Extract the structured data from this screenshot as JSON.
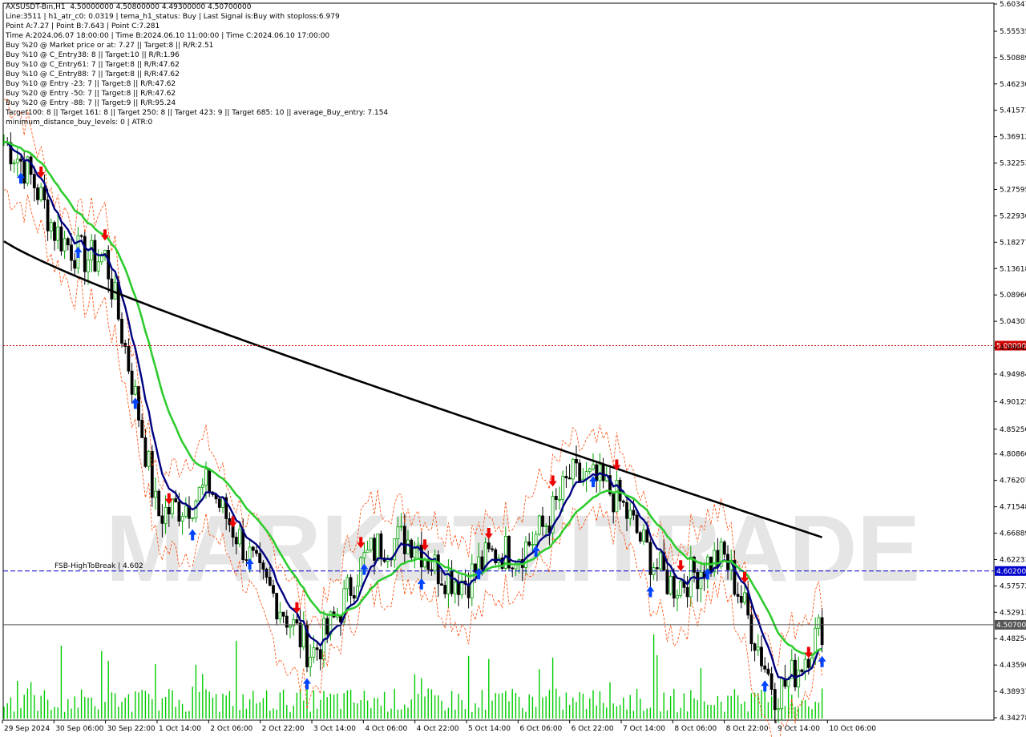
{
  "info_lines": [
    "AXSUSDT-Bin,H1  4.50000000 4.50800000 4.49300000 4.50700000",
    "Line:3511 | h1_atr_c0: 0.0319 | tema_h1_status: Buy | Last Signal is:Buy with stoploss:6.979",
    "Point A:7.27 | Point B:7.643 | Point C:7.281",
    "Time A:2024.06.07 18:00:00 | Time B:2024.06.10 11:00:00 | Time C:2024.06.10 17:00:00",
    "Buy %20 @ Market price or at: 7.27 || Target:8 || R/R:2.51",
    "Buy %10 @ C_Entry38: 8 || Target:10 || R/R:1.96",
    "Buy %10 @ C_Entry61: 7 || Target:8 || R/R:47.62",
    "Buy %10 @ C_Entry88: 7 || Target:8 || R/R:47.62",
    "Buy %10 @ Entry -23: 7 || Target:8 || R/R:47.62",
    "Buy %20 @ Entry -50: 7 || Target:8 || R/R:47.62",
    "Buy %20 @ Entry -88: 7 || Target:9 || R/R:95.24",
    "Target100: 8 || Target 161: 8 || Target 250: 8 || Target 423: 9 || Target 685: 10 || average_Buy_entry: 7.154",
    "minimum_distance_buy_levels: 0 | ATR:0"
  ],
  "watermark": "MARKETZITRADE",
  "price_labels": [
    "5.60347",
    "5.55535",
    "5.50889",
    "5.46230",
    "5.41571",
    "5.36912",
    "5.32253",
    "5.27595",
    "5.22936",
    "5.18277",
    "5.13618",
    "5.08960",
    "5.04301",
    "4.99642",
    "4.94984",
    "4.90125",
    "4.85250",
    "4.80866",
    "4.76207",
    "4.71548",
    "4.66889",
    "4.62231",
    "4.57572",
    "4.52913",
    "4.48254",
    "4.43596",
    "4.38937",
    "4.34278"
  ],
  "price_range": [
    4.34278,
    5.60347
  ],
  "time_labels": [
    "29 Sep 2024",
    "30 Sep 06:00",
    "30 Sep 22:00",
    "1 Oct 14:00",
    "2 Oct 06:00",
    "2 Oct 22:00",
    "3 Oct 14:00",
    "4 Oct 06:00",
    "4 Oct 22:00",
    "5 Oct 14:00",
    "6 Oct 06:00",
    "6 Oct 22:00",
    "7 Oct 14:00",
    "8 Oct 06:00",
    "8 Oct 22:00",
    "9 Oct 14:00",
    "10 Oct 06:00"
  ],
  "levels": [
    {
      "name": "level-5",
      "price": 5.0,
      "label": "5.00000",
      "color": "#d00000",
      "style": "dotted"
    },
    {
      "name": "fsb-high-to-break",
      "price": 4.602,
      "label": "4.60200",
      "caption": "FSB-HighToBreak | 4.602",
      "color": "#0000cc",
      "style": "dashed"
    },
    {
      "name": "current-price",
      "price": 4.507,
      "label": "4.50700",
      "color": "#555555",
      "style": "solid"
    }
  ],
  "colors": {
    "up": "#00a000",
    "down": "#000000",
    "ma_fast": "#000080",
    "ma_mid": "#2ecc2e",
    "ma_slow": "#000000",
    "envelope": "#ff4500",
    "buy_arrow": "#0044ff",
    "sell_arrow": "#ee0000",
    "volume": "#00cc00"
  },
  "chart_data": {
    "type": "candlestick",
    "symbol": "AXSUSDT-Bin",
    "timeframe": "H1",
    "last_ohlc": {
      "open": 4.5,
      "high": 4.508,
      "low": 4.493,
      "close": 4.507
    },
    "ylim": [
      4.34278,
      5.60347
    ],
    "series_anchors": [
      {
        "x": "29 Sep 2024",
        "price": 5.36
      },
      {
        "x": "30 Sep 06:00",
        "price": 5.2
      },
      {
        "x": "30 Sep 22:00",
        "price": 5.17
      },
      {
        "x": "1 Oct 14:00",
        "price": 4.68
      },
      {
        "x": "2 Oct 06:00",
        "price": 4.78
      },
      {
        "x": "2 Oct 22:00",
        "price": 4.56
      },
      {
        "x": "3 Oct 14:00",
        "price": 4.48
      },
      {
        "x": "4 Oct 06:00",
        "price": 4.6
      },
      {
        "x": "4 Oct 22:00",
        "price": 4.67
      },
      {
        "x": "5 Oct 14:00",
        "price": 4.58
      },
      {
        "x": "6 Oct 06:00",
        "price": 4.63
      },
      {
        "x": "6 Oct 22:00",
        "price": 4.78
      },
      {
        "x": "7 Oct 14:00",
        "price": 4.7
      },
      {
        "x": "8 Oct 06:00",
        "price": 4.6
      },
      {
        "x": "8 Oct 22:00",
        "price": 4.6
      },
      {
        "x": "9 Oct 14:00",
        "price": 4.41
      },
      {
        "x": "10 Oct 06:00",
        "price": 4.5
      }
    ],
    "moving_averages": [
      {
        "color": "navy",
        "role": "fast"
      },
      {
        "color": "green",
        "role": "medium"
      },
      {
        "color": "black",
        "role": "slow"
      }
    ]
  }
}
